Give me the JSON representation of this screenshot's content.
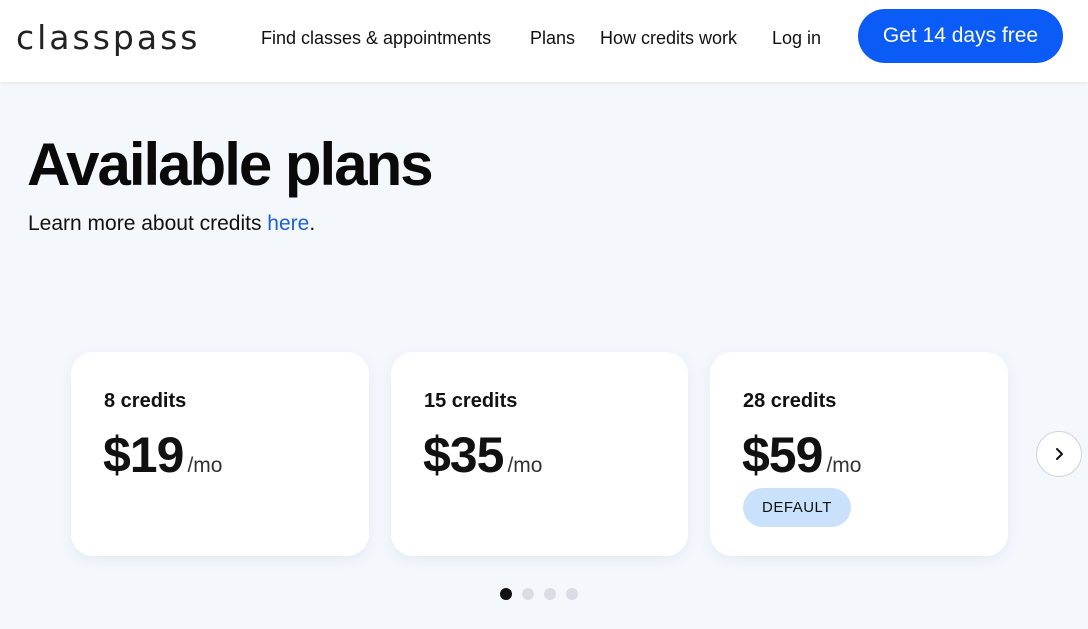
{
  "header": {
    "logo": "classpass",
    "nav": {
      "find": "Find classes & appointments",
      "plans": "Plans",
      "how": "How credits work",
      "login": "Log in"
    },
    "cta": "Get 14 days free"
  },
  "main": {
    "title": "Available plans",
    "subtitle_prefix": "Learn more about credits ",
    "subtitle_link": "here",
    "subtitle_suffix": "."
  },
  "plans": [
    {
      "credits": "8 credits",
      "price": "$19",
      "per": "/mo"
    },
    {
      "credits": "15 credits",
      "price": "$35",
      "per": "/mo"
    },
    {
      "credits": "28 credits",
      "price": "$59",
      "per": "/mo",
      "badge": "DEFAULT"
    }
  ],
  "carousel": {
    "next_icon": "chevron-right-icon",
    "pages": 4,
    "active_page": 1
  },
  "colors": {
    "accent": "#0b5cf6",
    "link": "#1b62d6",
    "badge_bg": "#c9e1fb",
    "page_bg": "#f4f8fd"
  }
}
